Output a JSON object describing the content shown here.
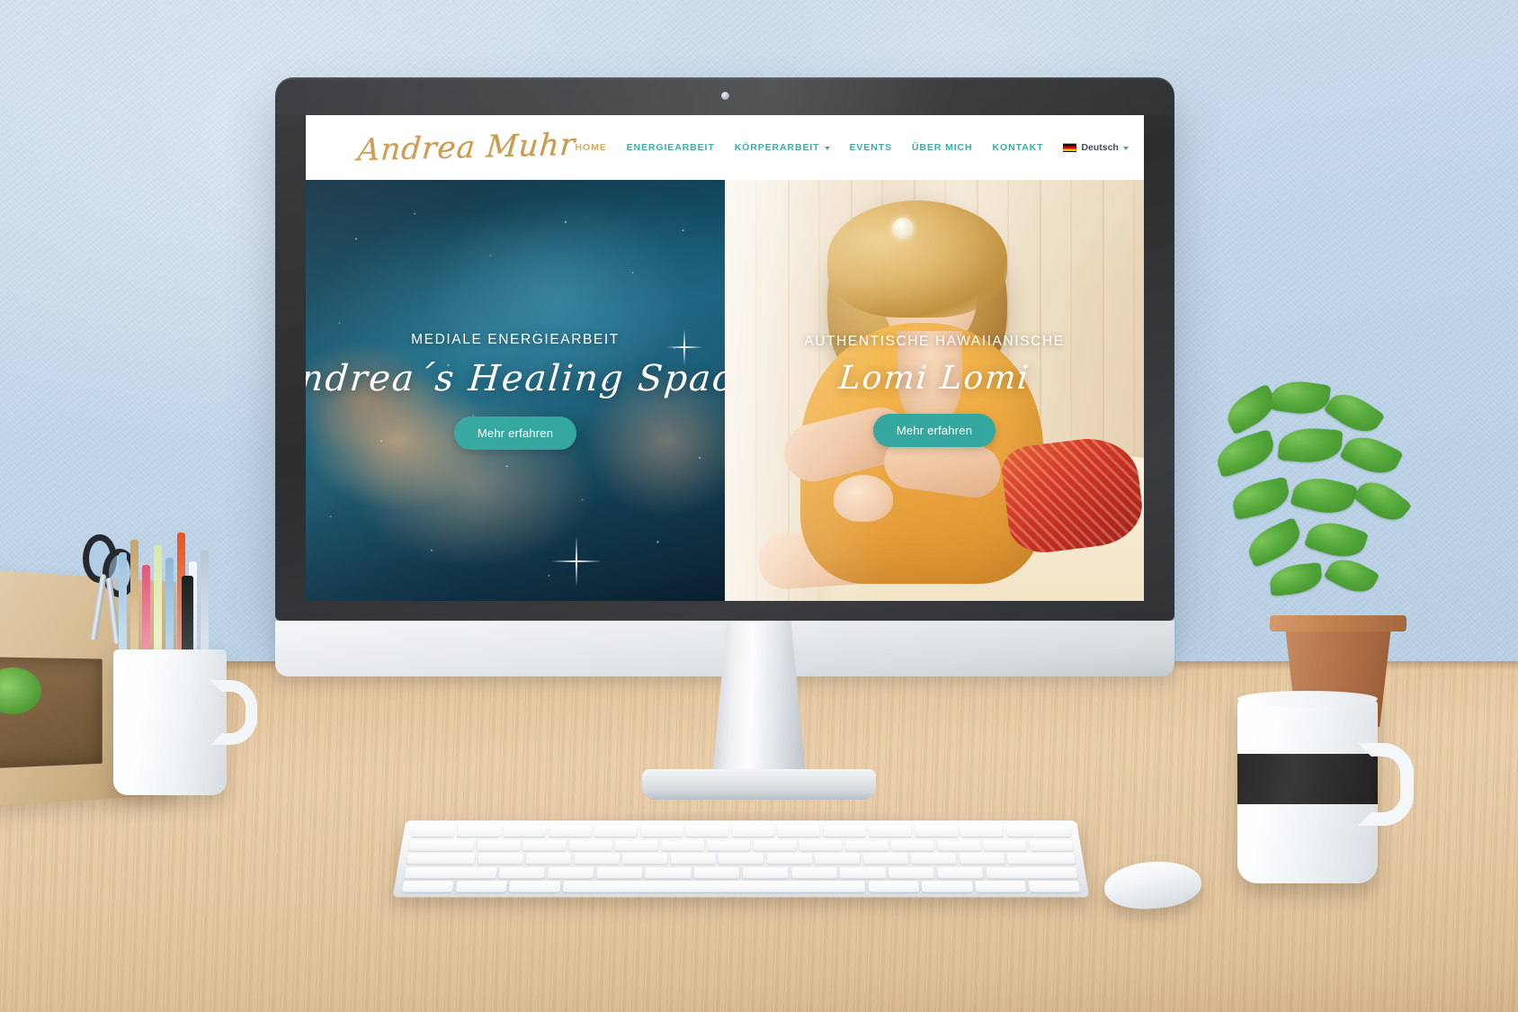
{
  "scene": {
    "description": "desktop-mockup-imac-on-wooden-desk",
    "wall_color": "#c3d7e9",
    "desk_color": "#e3c69f"
  },
  "website": {
    "brand": {
      "logo_text": "Andrea Muhr",
      "logo_color": "#c79a4c"
    },
    "nav": {
      "items": [
        {
          "label": "HOME",
          "active": true,
          "has_caret": false
        },
        {
          "label": "ENERGIEARBEIT",
          "active": false,
          "has_caret": false
        },
        {
          "label": "KÖRPERARBEIT",
          "active": false,
          "has_caret": true
        },
        {
          "label": "EVENTS",
          "active": false,
          "has_caret": false
        },
        {
          "label": "ÜBER MICH",
          "active": false,
          "has_caret": false
        },
        {
          "label": "KONTAKT",
          "active": false,
          "has_caret": false
        }
      ],
      "language": {
        "label": "Deutsch",
        "flag": "de-flag-icon",
        "has_caret": true
      },
      "cart": {
        "icon": "shopping-cart-icon",
        "glyph": "🛒"
      },
      "link_color": "#3dada4",
      "active_color": "#d4aa63"
    },
    "hero": {
      "panels": [
        {
          "id": "energiearbeit",
          "kicker": "MEDIALE ENERGIEARBEIT",
          "title": "Andrea´s Healing Space",
          "cta_label": "Mehr erfahren",
          "background": "nebula-space-image"
        },
        {
          "id": "lomi-lomi",
          "kicker": "AUTHENTISCHE HAWAIIANISCHE",
          "title": "Lomi Lomi",
          "cta_label": "Mehr erfahren",
          "background": "massage-therapist-photo"
        }
      ],
      "cta_color": "#34a8a0"
    }
  },
  "props": {
    "pen_cup": "white-mug-with-pens",
    "scissors": "scissors",
    "plant": "potted-green-plant",
    "mug": "white-and-black-coffee-mug",
    "keyboard": "apple-wireless-keyboard",
    "mouse": "computer-mouse",
    "shelf": "wooden-desk-shelf"
  }
}
